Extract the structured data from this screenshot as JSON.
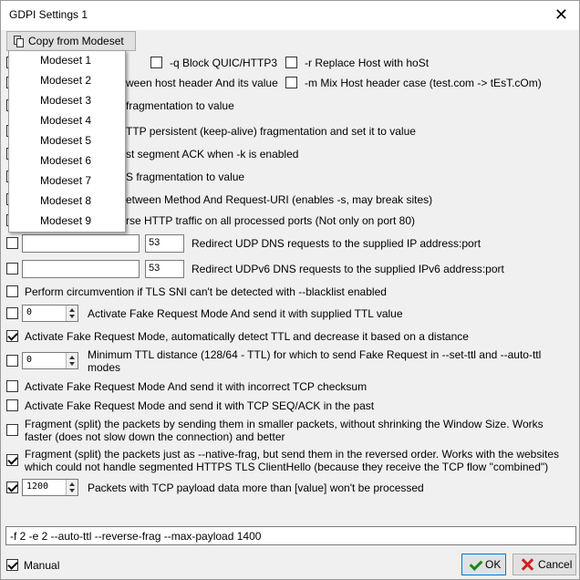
{
  "window": {
    "title": "GDPI Settings 1",
    "close_glyph": "✕"
  },
  "toolbar": {
    "copy_label": "Copy from Modeset",
    "copy_icon": "copy-icon"
  },
  "dropdown": {
    "items": [
      "Modeset 1",
      "Modeset 2",
      "Modeset 3",
      "Modeset 4",
      "Modeset 5",
      "Modeset 6",
      "Modeset 7",
      "Modeset 8",
      "Modeset 9"
    ]
  },
  "options": {
    "q": {
      "label": "-q Block QUIC/HTTP3",
      "checked": false
    },
    "r": {
      "label": "-r Replace Host with hoSt",
      "checked": false
    },
    "host_space": {
      "label": "ween host header And its value",
      "checked": false
    },
    "m": {
      "label": "-m Mix Host header case (test.com -> tEsT.cOm)",
      "checked": false
    },
    "frag_value": {
      "label": "fragmentation to value",
      "checked": false
    },
    "persistent": {
      "label": "TTP persistent (keep-alive) fragmentation and set it to value",
      "checked": false
    },
    "ack": {
      "label": "st segment ACK when -k is enabled",
      "checked": false
    },
    "https_frag": {
      "label": "S fragmentation to value",
      "checked": false
    },
    "method_space": {
      "label": "etween Method And Request-URI (enables -s, may break sites)",
      "checked": false
    },
    "all_ports": {
      "label": "rse HTTP traffic on all processed ports (Not only on port 80)",
      "checked": false
    },
    "dns": {
      "label": "Redirect UDP DNS requests to the supplied IP address:port",
      "checked": false,
      "ip": "",
      "port": "53"
    },
    "dnsv6": {
      "label": "Redirect UDPv6 DNS requests to the supplied IPv6 address:port",
      "checked": false,
      "ip": "",
      "port": "53"
    },
    "blacklist": {
      "label": "Perform circumvention if TLS SNI can't be detected with --blacklist enabled",
      "checked": false
    },
    "set_ttl": {
      "label": "Activate Fake Request Mode And send it with supplied TTL value",
      "checked": false,
      "value": "0"
    },
    "auto_ttl": {
      "label": "Activate Fake Request Mode, automatically detect TTL and decrease it based on a distance",
      "checked": true
    },
    "min_ttl": {
      "label": "Minimum TTL distance (128/64 - TTL) for which to send Fake Request in --set-ttl and --auto-ttl modes",
      "checked": false,
      "value": "0"
    },
    "wrong_chksum": {
      "label": "Activate Fake Request Mode And send it with incorrect TCP checksum",
      "checked": false
    },
    "wrong_seq": {
      "label": "Activate Fake Request Mode and send it with TCP SEQ/ACK in the past",
      "checked": false
    },
    "native_frag": {
      "label": "Fragment (split) the packets by sending them in smaller packets, without  shrinking the Window Size. Works faster (does not slow down the connection) and better",
      "checked": false
    },
    "reverse_frag": {
      "label": "Fragment (split) the packets just as --native-frag, but send them in the reversed order. Works with the websites which could not handle segmented HTTPS TLS ClientHello (because they receive the TCP flow \"combined\")",
      "checked": true
    },
    "max_payload": {
      "label": "Packets with TCP payload data more than [value] won't be processed",
      "checked": true,
      "value": "1200"
    }
  },
  "command_line": "-f 2 -e 2 --auto-ttl --reverse-frag  --max-payload 1400",
  "footer": {
    "manual_label": "Manual",
    "manual_checked": true,
    "ok_label": "OK",
    "cancel_label": "Cancel"
  }
}
